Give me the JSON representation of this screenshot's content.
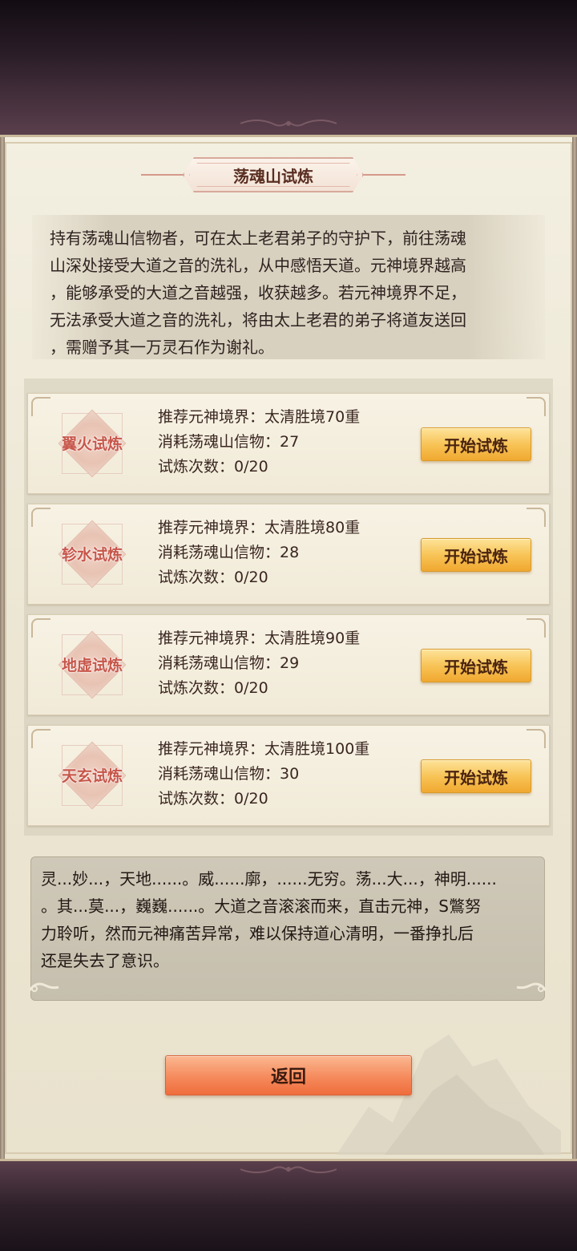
{
  "panel": {
    "title": "荡魂山试炼",
    "description": "持有荡魂山信物者，可在太上老君弟子的守护下，前往荡魂\n山深处接受大道之音的洗礼，从中感悟天道。元神境界越高\n，能够承受的大道之音越强，收获越多。若元神境界不足，\n无法承受大道之音的洗礼，将由太上老君的弟子将道友送回\n，需赠予其一万灵石作为谢礼。"
  },
  "trials": [
    {
      "name": "翼火试炼",
      "recommend_label": "推荐元神境界：",
      "recommend_value": "太清胜境70重",
      "cost_label": "消耗荡魂山信物：",
      "cost_value": "27",
      "count_label": "试炼次数：",
      "count_value": "0/20",
      "button": "开始试炼"
    },
    {
      "name": "轸水试炼",
      "recommend_label": "推荐元神境界：",
      "recommend_value": "太清胜境80重",
      "cost_label": "消耗荡魂山信物：",
      "cost_value": "28",
      "count_label": "试炼次数：",
      "count_value": "0/20",
      "button": "开始试炼"
    },
    {
      "name": "地虚试炼",
      "recommend_label": "推荐元神境界：",
      "recommend_value": "太清胜境90重",
      "cost_label": "消耗荡魂山信物：",
      "cost_value": "29",
      "count_label": "试炼次数：",
      "count_value": "0/20",
      "button": "开始试炼"
    },
    {
      "name": "天玄试炼",
      "recommend_label": "推荐元神境界：",
      "recommend_value": "太清胜境100重",
      "cost_label": "消耗荡魂山信物：",
      "cost_value": "30",
      "count_label": "试炼次数：",
      "count_value": "0/20",
      "button": "开始试炼"
    }
  ],
  "narrative": "灵...妙...，天地......。威......廓，......无穷。荡...大...，神明......\n。其...莫...，巍巍......。大道之音滚滚而来，直击元神，S鷩努\n力聆听，然而元神痛苦异常，难以保持道心清明，一番挣扎后\n还是失去了意识。",
  "footer": {
    "return_button": "返回"
  },
  "colors": {
    "start_button": "#f8c457",
    "return_button": "#f58a5c",
    "emblem_text": "#c7564a"
  }
}
